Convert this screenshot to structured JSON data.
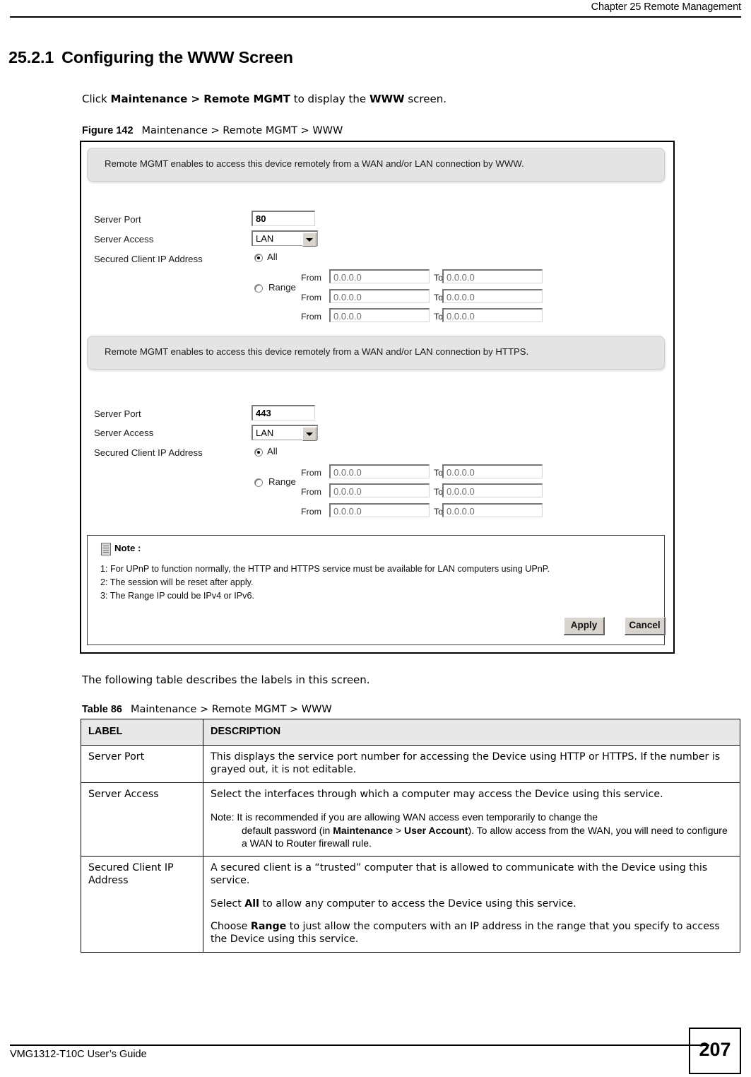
{
  "header": {
    "chapter_title": "Chapter 25 Remote Management"
  },
  "section": {
    "number": "25.2.1",
    "title": "Configuring the WWW Screen",
    "intro_before": "Click ",
    "intro_bold_1": "Maintenance > Remote MGMT",
    "intro_middle": " to display the ",
    "intro_bold_2": "WWW",
    "intro_after": " screen."
  },
  "figure": {
    "caption_label": "Figure 142",
    "caption_text": "Maintenance > Remote MGMT > WWW",
    "www_section": {
      "banner": "Remote MGMT enables to access this device remotely from a WAN and/or LAN connection by WWW.",
      "server_port_label": "Server Port",
      "server_port_value": "80",
      "server_access_label": "Server Access",
      "server_access_value": "LAN",
      "secured_client_label": "Secured Client IP Address",
      "all_label": "All",
      "range_label": "Range",
      "from_label": "From",
      "to_label": "To",
      "rows": [
        {
          "from": "0.0.0.0",
          "to": "0.0.0.0"
        },
        {
          "from": "0.0.0.0",
          "to": "0.0.0.0"
        },
        {
          "from": "0.0.0.0",
          "to": "0.0.0.0"
        }
      ]
    },
    "https_section": {
      "banner": "Remote MGMT enables to access this device remotely from a WAN and/or LAN connection by HTTPS.",
      "server_port_label": "Server Port",
      "server_port_value": "443",
      "server_access_label": "Server Access",
      "server_access_value": "LAN",
      "secured_client_label": "Secured Client IP Address",
      "all_label": "All",
      "range_label": "Range",
      "from_label": "From",
      "to_label": "To",
      "rows": [
        {
          "from": "0.0.0.0",
          "to": "0.0.0.0"
        },
        {
          "from": "0.0.0.0",
          "to": "0.0.0.0"
        },
        {
          "from": "0.0.0.0",
          "to": "0.0.0.0"
        }
      ]
    },
    "note": {
      "title": "Note :",
      "lines": [
        "1: For UPnP to function normally, the  HTTP and HTTPS service must be available for LAN computers using UPnP.",
        "2: The session will be reset after apply.",
        "3: The Range IP could be IPv4 or IPv6."
      ]
    },
    "buttons": {
      "apply": "Apply",
      "cancel": "Cancel"
    }
  },
  "following_text": "The following table describes the labels in this screen.",
  "table": {
    "caption_label": "Table 86",
    "caption_text": "Maintenance > Remote MGMT > WWW",
    "columns": [
      "LABEL",
      "DESCRIPTION"
    ],
    "rows": [
      {
        "label": "Server Port",
        "desc_p1": "This displays the service port number for accessing the Device using HTTP or HTTPS. If the number is grayed out, it is not editable."
      },
      {
        "label": "Server Access",
        "desc_p1": "Select the interfaces through which a computer may access the Device using this service.",
        "note_lead": "Note: It is recommended if you are allowing WAN access even temporarily to change the ",
        "note_hang_before": "default password (in ",
        "note_bold_1": "Maintenance",
        "note_between": " > ",
        "note_bold_2": "User Account",
        "note_hang_after": "). To allow access from the WAN, you will need to configure a WAN to Router firewall rule."
      },
      {
        "label": "Secured Client IP Address",
        "desc_p1": "A secured client is a “trusted” computer that is allowed to communicate with the Device using this service.",
        "desc_p2_before": "Select ",
        "desc_p2_bold": "All",
        "desc_p2_after": " to allow any computer to access the Device using this service.",
        "desc_p3_before": "Choose ",
        "desc_p3_bold": "Range",
        "desc_p3_after": " to just allow the computers with an IP address in the range that you specify to access the Device using this service."
      }
    ]
  },
  "footer": {
    "guide": "VMG1312-T10C User’s Guide",
    "page_number": "207"
  }
}
